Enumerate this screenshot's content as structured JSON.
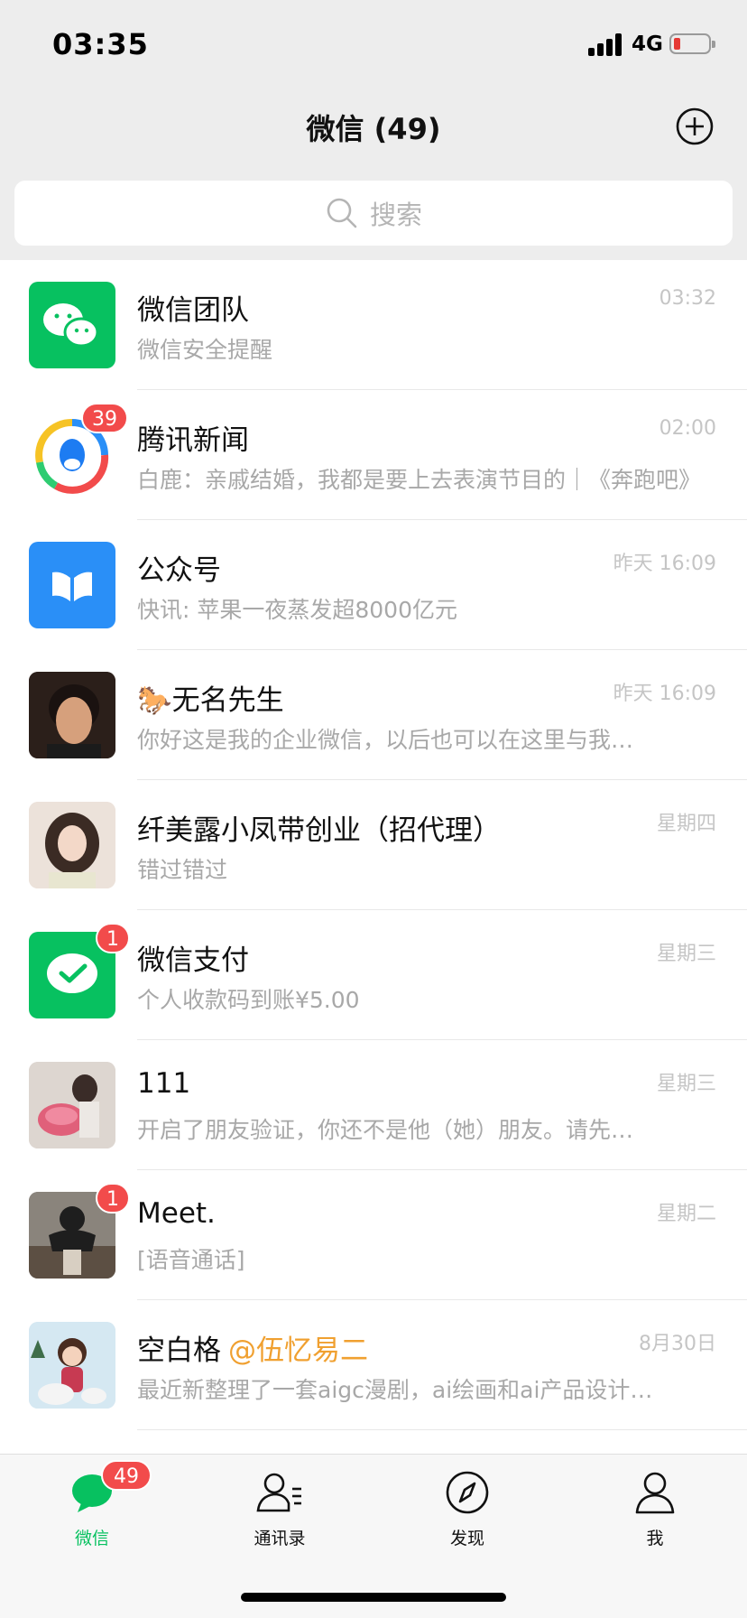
{
  "status_bar": {
    "time": "03:35",
    "network": "4G"
  },
  "header": {
    "title": "微信 (49)"
  },
  "search": {
    "placeholder": "搜索"
  },
  "chats": [
    {
      "name": "微信团队",
      "preview": "微信安全提醒",
      "time": "03:32",
      "avatar": "wechat-logo-icon"
    },
    {
      "name": "腾讯新闻",
      "preview": "白鹿：亲戚结婚，我都是要上去表演节目的｜《奔跑吧》",
      "time": "02:00",
      "badge": "39",
      "avatar": "tencent-news-logo-icon"
    },
    {
      "name": "公众号",
      "preview": "快讯: 苹果一夜蒸发超8000亿元",
      "time": "昨天 16:09",
      "avatar": "official-accounts-icon"
    },
    {
      "name": "🐎无名先生",
      "preview": "你好这是我的企业微信，以后也可以在这里与我…",
      "time": "昨天 16:09",
      "avatar": "man-portrait-avatar"
    },
    {
      "name": "纤美露小凤带创业（招代理）",
      "preview": "错过错过",
      "time": "星期四",
      "avatar": "woman-portrait-avatar"
    },
    {
      "name": "微信支付",
      "preview": "个人收款码到账¥5.00",
      "time": "星期三",
      "badge": "1",
      "avatar": "wechat-pay-icon"
    },
    {
      "name": "111",
      "preview": "开启了朋友验证，你还不是他（她）朋友。请先…",
      "time": "星期三",
      "avatar": "woman-with-flowers-avatar"
    },
    {
      "name": "Meet.",
      "preview": "[语音通话]",
      "time": "星期二",
      "badge": "1",
      "avatar": "person-in-hoodie-avatar"
    },
    {
      "name": "空白格",
      "mention": "@伍忆易二",
      "preview": "最近新整理了一套aigc漫剧，ai绘画和ai产品设计…",
      "time": "8月30日",
      "avatar": "cartoon-girl-avatar"
    }
  ],
  "tabbar": {
    "chats": {
      "label": "微信",
      "badge": "49"
    },
    "contacts": {
      "label": "通讯录"
    },
    "discover": {
      "label": "发现"
    },
    "me": {
      "label": "我"
    }
  },
  "colors": {
    "accent": "#07c160",
    "badge": "#f24b4b",
    "header_bg": "#ededed"
  }
}
